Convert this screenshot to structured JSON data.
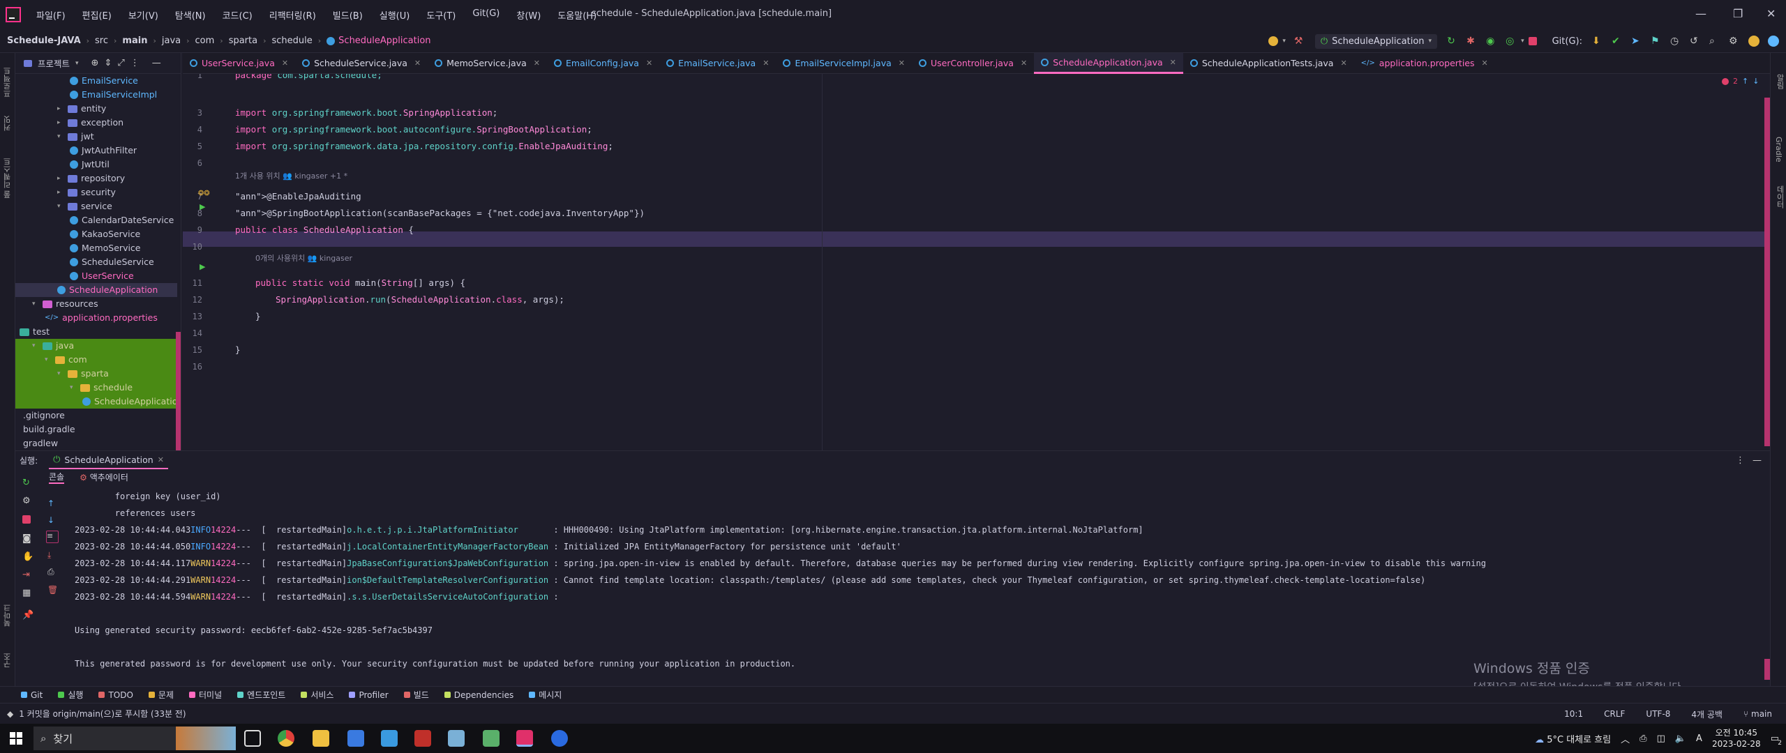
{
  "menu": [
    "파일(F)",
    "편집(E)",
    "보기(V)",
    "탐색(N)",
    "코드(C)",
    "리팩터링(R)",
    "빌드(B)",
    "실행(U)",
    "도구(T)",
    "Git(G)",
    "창(W)",
    "도움말(H)"
  ],
  "window_title": "schedule - ScheduleApplication.java [schedule.main]",
  "breadcrumbs": [
    "Schedule-JAVA",
    "src",
    "main",
    "java",
    "com",
    "sparta",
    "schedule",
    "ScheduleApplication"
  ],
  "navbar": {
    "run_config": "ScheduleApplication",
    "git_label": "Git(G):"
  },
  "project": {
    "title": "프로젝트",
    "tree": [
      {
        "label": "EmailService",
        "kind": "class",
        "depth": 3,
        "color": "blue"
      },
      {
        "label": "EmailServiceImpl",
        "kind": "class",
        "depth": 3,
        "color": "blue"
      },
      {
        "label": "entity",
        "kind": "folder",
        "depth": 2,
        "color": "gray",
        "arrow": "▸"
      },
      {
        "label": "exception",
        "kind": "folder",
        "depth": 2,
        "color": "gray",
        "arrow": "▸"
      },
      {
        "label": "jwt",
        "kind": "folder",
        "depth": 2,
        "color": "gray",
        "arrow": "▾"
      },
      {
        "label": "JwtAuthFilter",
        "kind": "class",
        "depth": 3,
        "color": "gray"
      },
      {
        "label": "JwtUtil",
        "kind": "class",
        "depth": 3,
        "color": "gray"
      },
      {
        "label": "repository",
        "kind": "folder",
        "depth": 2,
        "color": "gray",
        "arrow": "▸"
      },
      {
        "label": "security",
        "kind": "folder",
        "depth": 2,
        "color": "gray",
        "arrow": "▸"
      },
      {
        "label": "service",
        "kind": "folder",
        "depth": 2,
        "color": "gray",
        "arrow": "▾"
      },
      {
        "label": "CalendarDateService",
        "kind": "class",
        "depth": 3,
        "color": "gray"
      },
      {
        "label": "KakaoService",
        "kind": "class",
        "depth": 3,
        "color": "gray"
      },
      {
        "label": "MemoService",
        "kind": "class",
        "depth": 3,
        "color": "gray"
      },
      {
        "label": "ScheduleService",
        "kind": "class",
        "depth": 3,
        "color": "gray"
      },
      {
        "label": "UserService",
        "kind": "class",
        "depth": 3,
        "color": "pink"
      },
      {
        "label": "ScheduleApplication",
        "kind": "class",
        "depth": 2,
        "color": "pink"
      },
      {
        "label": "resources",
        "kind": "folder",
        "depth": 0,
        "color": "gray",
        "arrow": "▾"
      },
      {
        "label": "application.properties",
        "kind": "props",
        "depth": 1,
        "color": "pink"
      },
      {
        "label": "test",
        "kind": "folder",
        "depth": -1,
        "color": "gray"
      },
      {
        "label": "java",
        "kind": "folder",
        "depth": 0,
        "color": "green",
        "arrow": "▾"
      },
      {
        "label": "com",
        "kind": "folder",
        "depth": 1,
        "color": "green",
        "arrow": "▾"
      },
      {
        "label": "sparta",
        "kind": "folder",
        "depth": 2,
        "color": "green",
        "arrow": "▾"
      },
      {
        "label": "schedule",
        "kind": "folder",
        "depth": 3,
        "color": "green",
        "arrow": "▾"
      },
      {
        "label": "ScheduleApplicationTests",
        "kind": "class",
        "depth": 4,
        "color": "green"
      },
      {
        "label": ".gitignore",
        "kind": "file",
        "depth": -1,
        "color": "gray"
      },
      {
        "label": "build.gradle",
        "kind": "file",
        "depth": -1,
        "color": "gray"
      },
      {
        "label": "gradlew",
        "kind": "file",
        "depth": -1,
        "color": "gray"
      }
    ]
  },
  "tabs": [
    {
      "label": "UserService.java",
      "color": "#ff6bc1"
    },
    {
      "label": "ScheduleService.java",
      "color": "#d8d8e6"
    },
    {
      "label": "MemoService.java",
      "color": "#d8d8e6"
    },
    {
      "label": "EmailConfig.java",
      "color": "#5fb8ff"
    },
    {
      "label": "EmailService.java",
      "color": "#5fb8ff"
    },
    {
      "label": "EmailServiceImpl.java",
      "color": "#5fb8ff"
    },
    {
      "label": "UserController.java",
      "color": "#ff6bc1"
    },
    {
      "label": "ScheduleApplication.java",
      "color": "#ff6bc1",
      "active": true
    },
    {
      "label": "ScheduleApplicationTests.java",
      "color": "#d8d8e6"
    },
    {
      "label": "application.properties",
      "color": "#ff6bc1"
    }
  ],
  "editor": {
    "error_count": "2",
    "lines": [
      {
        "n": "1",
        "text": "package com.sparta.schedule;"
      },
      {
        "n": "3",
        "text": "import org.springframework.boot.SpringApplication;"
      },
      {
        "n": "4",
        "text": "import org.springframework.boot.autoconfigure.SpringBootApplication;"
      },
      {
        "n": "5",
        "text": "import org.springframework.data.jpa.repository.config.EnableJpaAuditing;"
      },
      {
        "n": "6",
        "text": ""
      },
      {
        "n": "7",
        "text": "@EnableJpaAuditing"
      },
      {
        "n": "8",
        "text": "@SpringBootApplication(scanBasePackages = {\"net.codejava.InventoryApp\"})"
      },
      {
        "n": "9",
        "text": "public class ScheduleApplication {"
      },
      {
        "n": "10",
        "text": ""
      },
      {
        "n": "11",
        "text": "public static void main(String[] args) {"
      },
      {
        "n": "12",
        "text": "SpringApplication.run(ScheduleApplication.class, args);"
      },
      {
        "n": "13",
        "text": "}"
      },
      {
        "n": "14",
        "text": ""
      },
      {
        "n": "15",
        "text": "}"
      },
      {
        "n": "16",
        "text": ""
      }
    ],
    "hint1": "1개 사용 위치   👥 kingaser +1 *",
    "hint2": "0개의 사용위치   👥 kingaser"
  },
  "run": {
    "label": "실행:",
    "tab": "ScheduleApplication",
    "sub_console": "콘솔",
    "sub_actuator": "액추에이터",
    "console": [
      {
        "text": "        foreign key (user_id)"
      },
      {
        "text": "        references users"
      },
      {
        "date": "2023-02-28 10:44:44.043",
        "level": "INFO",
        "pid": "14224",
        "thread": "---  [  restartedMain]",
        "logger": "o.h.e.t.j.p.i.JtaPlatformInitiator      ",
        "msg": " : HHH000490: Using JtaPlatform implementation: [org.hibernate.engine.transaction.jta.platform.internal.NoJtaPlatform]"
      },
      {
        "date": "2023-02-28 10:44:44.050",
        "level": "INFO",
        "pid": "14224",
        "thread": "---  [  restartedMain]",
        "logger": "j.LocalContainerEntityManagerFactoryBean",
        "msg": " : Initialized JPA EntityManagerFactory for persistence unit 'default'"
      },
      {
        "date": "2023-02-28 10:44:44.117",
        "level": "WARN",
        "pid": "14224",
        "thread": "---  [  restartedMain]",
        "logger": "JpaBaseConfiguration$JpaWebConfiguration",
        "msg": " : spring.jpa.open-in-view is enabled by default. Therefore, database queries may be performed during view rendering. Explicitly configure spring.jpa.open-in-view to disable this warning"
      },
      {
        "date": "2023-02-28 10:44:44.291",
        "level": "WARN",
        "pid": "14224",
        "thread": "---  [  restartedMain]",
        "logger": "ion$DefaultTemplateResolverConfiguration",
        "msg": " : Cannot find template location: classpath:/templates/ (please add some templates, check your Thymeleaf configuration, or set spring.thymeleaf.check-template-location=false)"
      },
      {
        "date": "2023-02-28 10:44:44.594",
        "level": "WARN",
        "pid": "14224",
        "thread": "---  [  restartedMain]",
        "logger": ".s.s.UserDetailsServiceAutoConfiguration",
        "msg": " :"
      },
      {
        "text": ""
      },
      {
        "text": "Using generated security password: eecb6fef-6ab2-452e-9285-5ef7ac5b4397"
      },
      {
        "text": ""
      },
      {
        "text": "This generated password is for development use only. Your security configuration must be updated before running your application in production."
      }
    ]
  },
  "activation": {
    "title": "Windows 정품 인증",
    "subtitle": "[설정]으로 이동하여 Windows를 정품 인증합니다."
  },
  "tool_tabs": [
    {
      "label": "Git",
      "color": "#5fb8ff"
    },
    {
      "label": "실행",
      "color": "#4ec94e"
    },
    {
      "label": "TODO",
      "color": "#e06666"
    },
    {
      "label": "문제",
      "color": "#e5b23a"
    },
    {
      "label": "터미널",
      "color": "#ff6bc1"
    },
    {
      "label": "엔드포인트",
      "color": "#5fd3c9"
    },
    {
      "label": "서비스",
      "color": "#c3e060"
    },
    {
      "label": "Profiler",
      "color": "#9f9fff"
    },
    {
      "label": "빌드",
      "color": "#e06666"
    },
    {
      "label": "Dependencies",
      "color": "#c3e060"
    },
    {
      "label": "메시지",
      "color": "#5fb8ff"
    }
  ],
  "status": {
    "git_msg": "1 커밋을 origin/main(으)로 푸시함 (33분 전)",
    "position": "10:1",
    "line_sep": "CRLF",
    "encoding": "UTF-8",
    "indent": "4개 공백",
    "branch": "main"
  },
  "taskbar": {
    "search_placeholder": "찾기",
    "weather": "5°C 대체로 흐림",
    "ime": "A",
    "time": "오전 10:45",
    "date": "2023-02-28",
    "notif_count": "2"
  }
}
